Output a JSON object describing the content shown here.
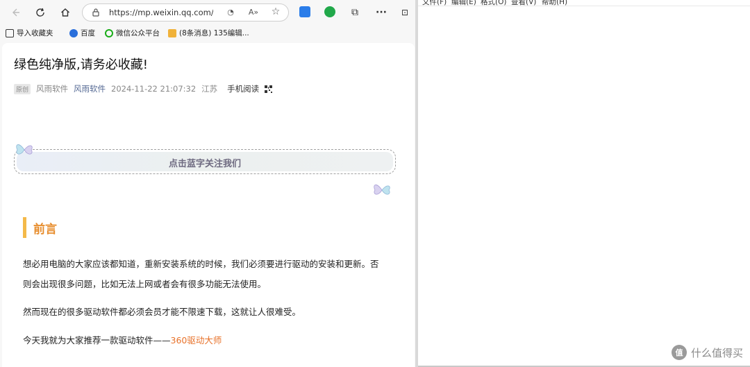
{
  "browser": {
    "address_url": "https://mp.weixin.qq.com/s?...",
    "bookmarks": [
      {
        "label": "导入收藏夹"
      },
      {
        "label": "百度"
      },
      {
        "label": "微信公众平台"
      },
      {
        "label": "(8条消息) 135编辑..."
      }
    ]
  },
  "article": {
    "title": "绿色纯净版,请务必收藏!",
    "tag": "原创",
    "author": "风雨软件",
    "account": "风雨软件",
    "datetime": "2024-11-22 21:07:32",
    "location": "江苏",
    "mobile_read": "手机阅读",
    "banner_text": "点击蓝字关注我们",
    "section_heading": "前言",
    "para1_line1": "想必用电脑的大家应该都知道，重新安装系统的时候，我们必须要进行驱动的安装和更新。否",
    "para1_line2": "则会出现很多问题，比如无法上网或者会有很多功能无法使用。",
    "para2": "然而现在的很多驱动软件都必须会员才能不限速下载，这就让人很难受。",
    "para3_prefix": "今天我就为大家推荐一款驱动软件——",
    "para3_highlight": "360驱动大师"
  },
  "editor": {
    "menus": [
      "文件(F)",
      "编辑(E)",
      "格式(O)",
      "查看(V)",
      "帮助(H)"
    ]
  },
  "watermark": {
    "logo_text": "值",
    "text": "什么值得买"
  },
  "colors": {
    "accent_orange": "#e8722a",
    "heading_orange": "#e78d2d",
    "bar_yellow": "#f4b949",
    "link_blue": "#576b95"
  }
}
